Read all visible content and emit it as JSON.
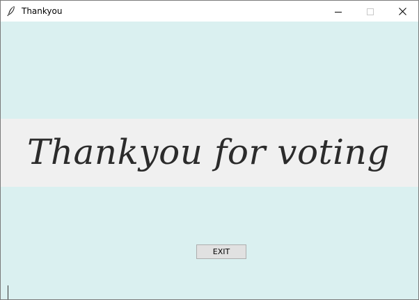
{
  "window": {
    "title": "Thankyou",
    "app_icon": "feather-icon",
    "controls": {
      "minimize_icon": "minimize-icon",
      "maximize_icon": "maximize-icon",
      "close_icon": "close-icon"
    }
  },
  "main": {
    "message": "Thankyou for voting",
    "exit_label": "EXIT"
  },
  "colors": {
    "background": "#daf0f0",
    "banner": "#f0f0f0",
    "text": "#2b2b2b",
    "button": "#e1e1e1"
  }
}
